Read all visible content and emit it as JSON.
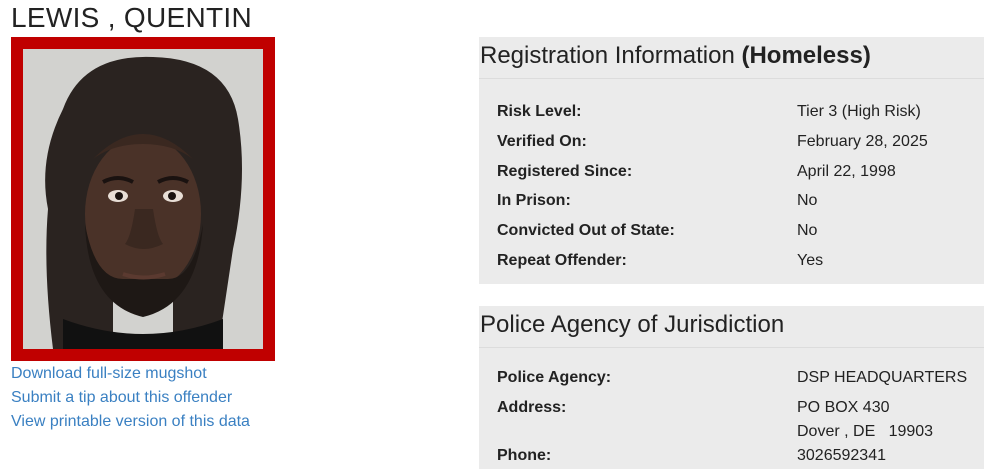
{
  "offender": {
    "name": "LEWIS , QUENTIN"
  },
  "mugshot_links": [
    "Download full-size mugshot",
    "Submit a tip about this offender",
    "View printable version of this data"
  ],
  "registration": {
    "title": "Registration Information",
    "status": "(Homeless)",
    "fields": [
      {
        "label": "Risk Level:",
        "value": "Tier 3 (High Risk)"
      },
      {
        "label": "Verified On:",
        "value": "February 28, 2025"
      },
      {
        "label": "Registered Since:",
        "value": "April 22, 1998"
      },
      {
        "label": "In Prison:",
        "value": "No"
      },
      {
        "label": "Convicted Out of State:",
        "value": "No"
      },
      {
        "label": "Repeat Offender:",
        "value": "Yes"
      }
    ]
  },
  "jurisdiction": {
    "title": "Police Agency of Jurisdiction",
    "agency_label": "Police Agency:",
    "agency_value": "DSP HEADQUARTERS",
    "address_label": "Address:",
    "address_line1": "PO BOX 430",
    "address_line2": "Dover , DE   19903",
    "phone_label": "Phone:",
    "phone_value": "3026592341"
  },
  "colors": {
    "frame": "#c00000",
    "link": "#3a80c2",
    "panel_bg": "#ebebeb"
  }
}
